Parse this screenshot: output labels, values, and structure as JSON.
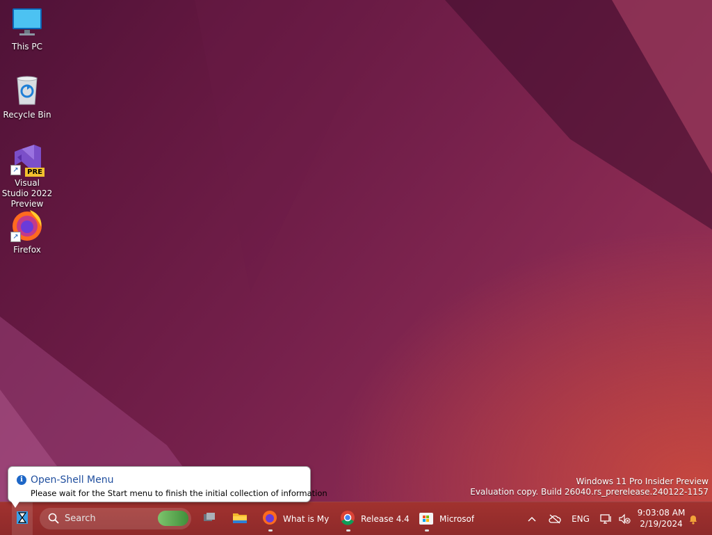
{
  "desktop": {
    "icons": [
      {
        "label": "This PC",
        "icon": "computer-icon"
      },
      {
        "label": "Recycle Bin",
        "icon": "recycle-bin-icon"
      },
      {
        "label": "Visual Studio 2022 Preview",
        "icon": "visual-studio-icon",
        "badge": "PRE"
      },
      {
        "label": "Firefox",
        "icon": "firefox-icon"
      }
    ]
  },
  "watermark": {
    "line1": "Windows 11 Pro Insider Preview",
    "line2": "Evaluation copy. Build 26040.rs_prerelease.240122-1157"
  },
  "balloon": {
    "title": "Open-Shell Menu",
    "message": "Please wait for the Start menu to finish the initial collection of information",
    "icon": "info-icon"
  },
  "taskbar": {
    "start_icon": "start-hourglass-icon",
    "search_placeholder": "Search",
    "apps": [
      {
        "label": "",
        "icon": "task-view-icon"
      },
      {
        "label": "",
        "icon": "file-explorer-icon"
      },
      {
        "label": "What is My",
        "icon": "firefox-icon",
        "running": true
      },
      {
        "label": "Release 4.4.",
        "icon": "chrome-icon",
        "running": true
      },
      {
        "label": "Microsof",
        "icon": "microsoft-store-icon",
        "running": true
      }
    ],
    "tray": {
      "chevron_icon": "chevron-up-icon",
      "cloud_icon": "onedrive-offline-icon",
      "language": "ENG",
      "network_icon": "network-icon",
      "volume_icon": "volume-muted-icon",
      "time": "9:03:08 AM",
      "date": "2/19/2024",
      "notification_icon": "bell-icon"
    }
  },
  "colors": {
    "taskbar": "#9a2f2d",
    "accent": "#1f4e9e"
  }
}
